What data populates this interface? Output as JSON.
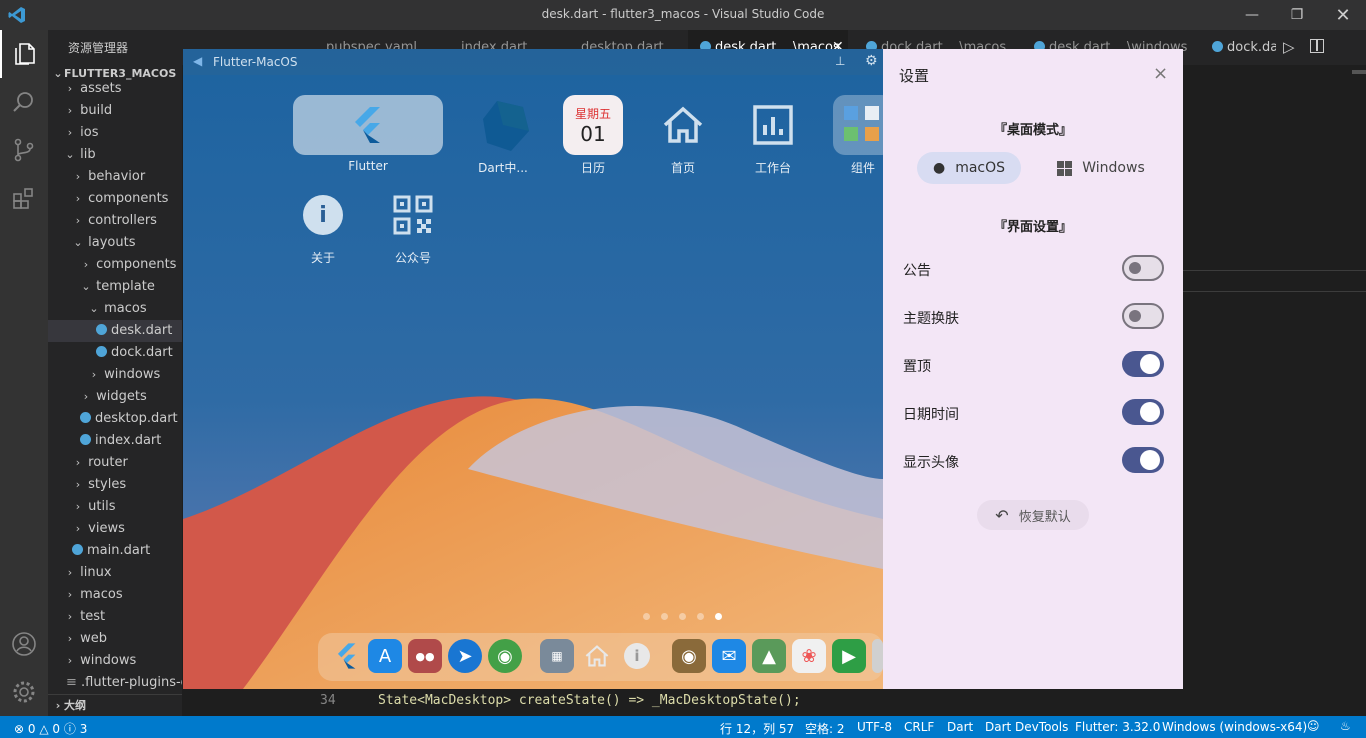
{
  "window": {
    "title": "desk.dart - flutter3_macos - Visual Studio Code"
  },
  "sidebar": {
    "header": "资源管理器",
    "header_more": "···",
    "project": "FLUTTER3_MACOS",
    "items": [
      {
        "label": "assets"
      },
      {
        "label": "build"
      },
      {
        "label": "ios"
      },
      {
        "label": "lib"
      },
      {
        "label": "behavior"
      },
      {
        "label": "components"
      },
      {
        "label": "controllers"
      },
      {
        "label": "layouts"
      },
      {
        "label": "components"
      },
      {
        "label": "template"
      },
      {
        "label": "macos"
      },
      {
        "label": "desk.dart"
      },
      {
        "label": "dock.dart"
      },
      {
        "label": "windows"
      },
      {
        "label": "widgets"
      },
      {
        "label": "desktop.dart"
      },
      {
        "label": "index.dart"
      },
      {
        "label": "router"
      },
      {
        "label": "styles"
      },
      {
        "label": "utils"
      },
      {
        "label": "views"
      },
      {
        "label": "main.dart"
      },
      {
        "label": "linux"
      },
      {
        "label": "macos"
      },
      {
        "label": "test"
      },
      {
        "label": "web"
      },
      {
        "label": "windows"
      },
      {
        "label": ".flutter-plugins-de"
      }
    ],
    "outline": "大纲"
  },
  "tabs": [
    {
      "label": "pubspec.yaml"
    },
    {
      "label": "index.dart"
    },
    {
      "label": "desktop.dart"
    },
    {
      "label": "desk.dart ...\\macos"
    },
    {
      "label": "dock.dart ...\\macos"
    },
    {
      "label": "desk.dart ...\\windows"
    },
    {
      "label": "dock.dar"
    }
  ],
  "editor": {
    "line_number": "34",
    "code_line": "State<MacDesktop> createState() => _MacDesktopState();"
  },
  "flutter_window": {
    "title": "Flutter-MacOS",
    "apps": [
      {
        "label": "Flutter"
      },
      {
        "label": "Dart中..."
      },
      {
        "label": "日历",
        "weekday": "星期五",
        "day": "01"
      },
      {
        "label": "首页"
      },
      {
        "label": "工作台"
      },
      {
        "label": "组件"
      },
      {
        "label": "关于"
      },
      {
        "label": "公众号"
      }
    ]
  },
  "settings": {
    "title": "设置",
    "close": "×",
    "desktop_mode_title": "『桌面模式』",
    "mode_macos": "macOS",
    "mode_windows": "Windows",
    "ui_settings_title": "『界面设置』",
    "rows": [
      {
        "label": "公告",
        "on": false
      },
      {
        "label": "主题换肤",
        "on": false
      },
      {
        "label": "置顶",
        "on": true
      },
      {
        "label": "日期时间",
        "on": true
      },
      {
        "label": "显示头像",
        "on": true
      }
    ],
    "reset_label": "恢复默认"
  },
  "status": {
    "errors": "0",
    "warnings": "0",
    "info": "3",
    "position": "行 12，列 57",
    "spaces": "空格: 2",
    "encoding": "UTF-8",
    "eol": "CRLF",
    "language": "Dart",
    "devtools": "Dart DevTools",
    "flutter": "Flutter: 3.32.0",
    "device": "Windows (windows-x64)"
  },
  "colors": {
    "accent": "#007acc",
    "toggle_on": "#4a5790",
    "settings_bg": "#f3e6f6"
  }
}
